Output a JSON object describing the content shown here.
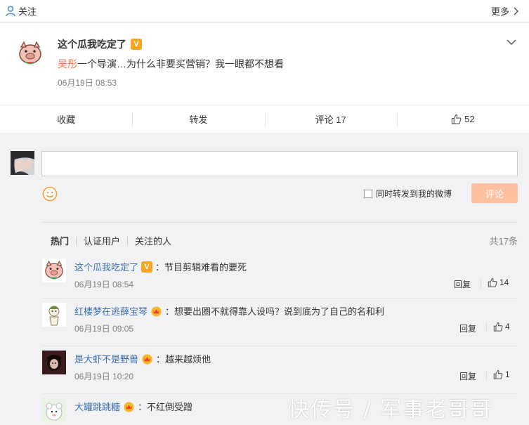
{
  "topbar": {
    "follow_label": "关注",
    "more_label": "更多"
  },
  "post": {
    "author": "这个瓜我吃定了",
    "mention": "吴彤",
    "text": "一个导演…为什么非要买营销？我一眼都不想看",
    "time": "06月19日 08:53"
  },
  "actions": {
    "favorite": "收藏",
    "forward": "转发",
    "comment": "评论 17",
    "like_count": "52"
  },
  "composer": {
    "forward_checkbox_label": "同时转发到我的微博",
    "submit_label": "评论"
  },
  "filter": {
    "tabs": [
      "热门",
      "认证用户",
      "关注的人"
    ],
    "total": "共17条"
  },
  "comments": [
    {
      "user": "这个瓜我吃定了",
      "badge": "V",
      "text": "：节目剪辑难看的要死",
      "time": "06月19日 08:54",
      "reply": "回复",
      "likes": "14"
    },
    {
      "user": "红楼梦在逃薛宝琴",
      "badge": "crown",
      "text": "：想要出圈不就得靠人设吗？说到底为了自己的名和利",
      "time": "06月19日 09:05",
      "reply": "回复",
      "likes": "4"
    },
    {
      "user": "是大虾不是野兽",
      "badge": "crown",
      "text": "：越来越烦他",
      "time": "06月19日 10:20",
      "reply": "回复",
      "likes": "1"
    },
    {
      "user": "大罐跳跳糖",
      "badge": "crown",
      "text": "：不红倒受蹭",
      "time": "",
      "reply": "",
      "likes": ""
    }
  ],
  "watermark": "快传号 / 军事老哥哥",
  "colors": {
    "accent": "#eb7350",
    "link": "#3a6fb0",
    "submit_disabled": "#ffc09f"
  }
}
